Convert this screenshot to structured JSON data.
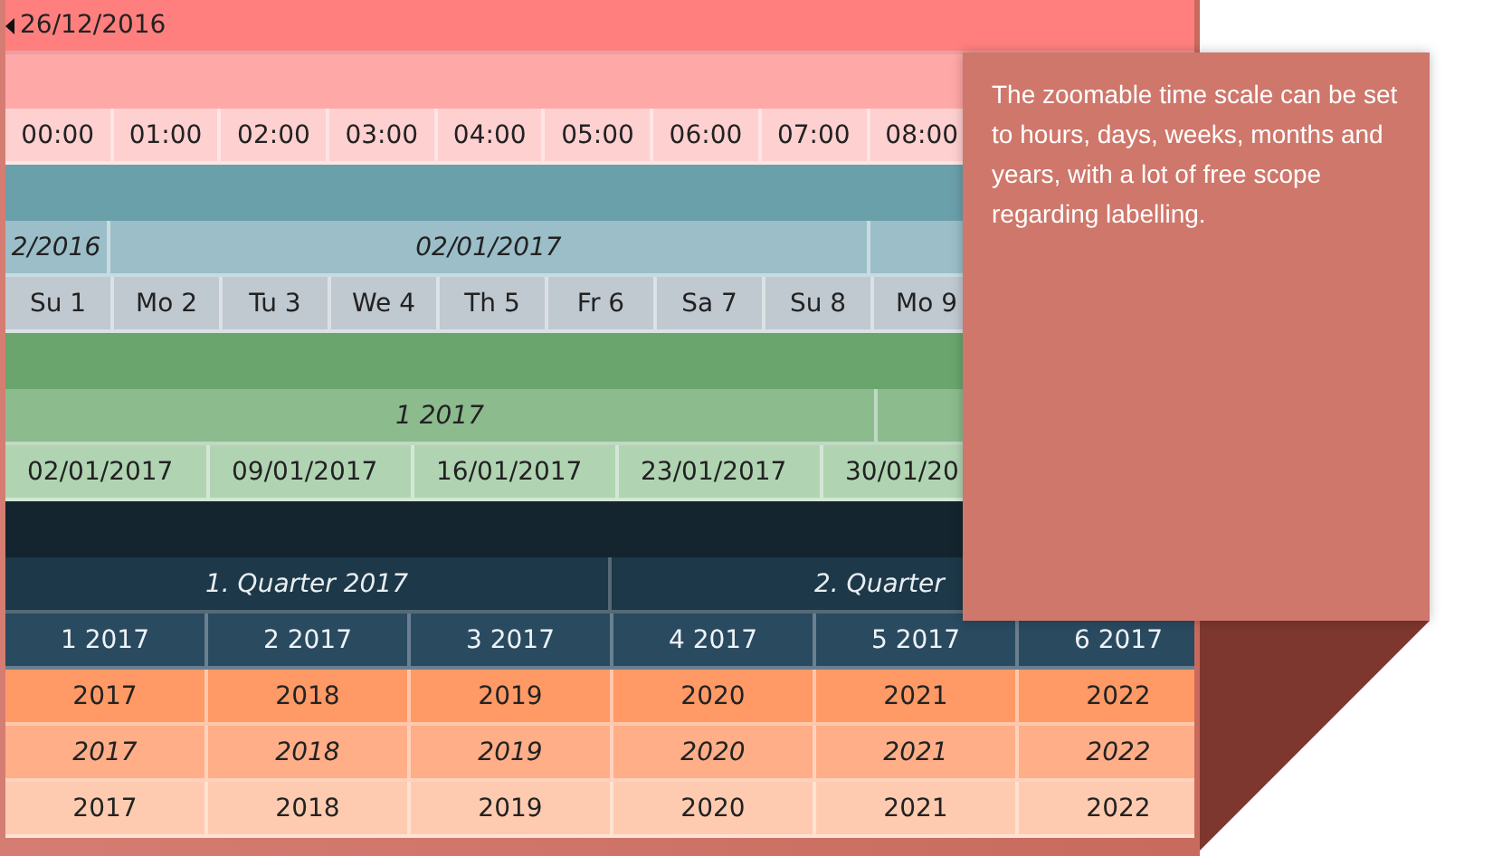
{
  "scales": [
    {
      "kind": "hours",
      "title": "26/12/2016",
      "units": [
        "00:00",
        "01:00",
        "02:00",
        "03:00",
        "04:00",
        "05:00",
        "06:00",
        "07:00",
        "08:00"
      ]
    },
    {
      "kind": "days",
      "groups": [
        "2/2016",
        "02/01/2017"
      ],
      "units": [
        "Su 1",
        "Mo 2",
        "Tu 3",
        "We 4",
        "Th 5",
        "Fr 6",
        "Sa 7",
        "Su 8",
        "Mo 9"
      ]
    },
    {
      "kind": "weeks",
      "groups": [
        "1 2017"
      ],
      "units": [
        "02/01/2017",
        "09/01/2017",
        "16/01/2017",
        "23/01/2017",
        "30/01/20"
      ]
    },
    {
      "kind": "months",
      "groups": [
        "1. Quarter 2017",
        "2. Quarter"
      ],
      "units": [
        "1 2017",
        "2 2017",
        "3 2017",
        "4 2017",
        "5 2017",
        "6 2017"
      ]
    },
    {
      "kind": "years",
      "rows": [
        {
          "italic": false,
          "cells": [
            "2017",
            "2018",
            "2019",
            "2020",
            "2021",
            "2022"
          ]
        },
        {
          "italic": true,
          "cells": [
            "2017",
            "2018",
            "2019",
            "2020",
            "2021",
            "2022"
          ]
        },
        {
          "italic": false,
          "cells": [
            "2017",
            "2018",
            "2019",
            "2020",
            "2021",
            "2022"
          ]
        }
      ]
    }
  ],
  "callout": {
    "text": "The zoomable time scale can be set to hours, days, weeks, months and years, with a lot of free scope regarding labelling."
  }
}
